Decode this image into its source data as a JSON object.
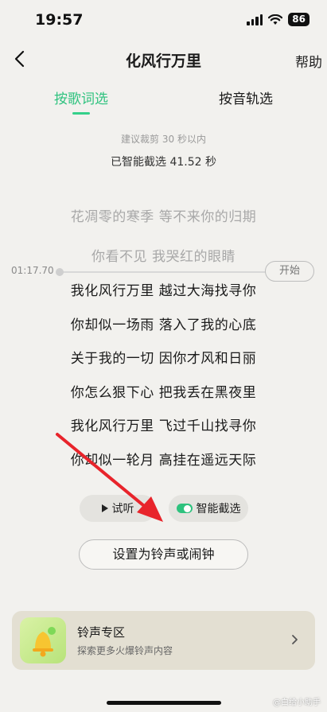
{
  "status_bar": {
    "time": "19:57",
    "battery": "86"
  },
  "nav": {
    "title": "化风行万里",
    "help_label": "帮助"
  },
  "tabs": [
    {
      "label": "按歌词选",
      "active": true
    },
    {
      "label": "按音轨选",
      "active": false
    }
  ],
  "clip": {
    "hint": "建议裁剪 30 秒以内",
    "selected": "已智能截选 41.52 秒"
  },
  "timeline": {
    "time": "01:17.70",
    "start_label": "开始"
  },
  "lyrics": [
    {
      "text": "花凋零的寒季 等不来你的归期",
      "state": "dim"
    },
    {
      "text": "你看不见 我哭红的眼睛",
      "state": "dim"
    },
    {
      "text": "我化风行万里 越过大海找寻你",
      "state": "active"
    },
    {
      "text": "你却似一场雨 落入了我的心底",
      "state": "active"
    },
    {
      "text": "关于我的一切 因你才风和日丽",
      "state": "active"
    },
    {
      "text": "你怎么狠下心 把我丢在黑夜里",
      "state": "active"
    },
    {
      "text": "我化风行万里 飞过千山找寻你",
      "state": "active"
    },
    {
      "text": "你却似一轮月 高挂在遥远天际",
      "state": "active"
    }
  ],
  "controls": {
    "preview_label": "试听",
    "smart_label": "智能截选",
    "smart_enabled": true,
    "set_ringtone_label": "设置为铃声或闹钟"
  },
  "banner": {
    "title": "铃声专区",
    "subtitle": "探索更多火爆铃声内容"
  },
  "watermark": "@白给小助手",
  "colors": {
    "accent": "#2ec27e",
    "arrow": "#e8242b",
    "background": "#f2f1ee"
  }
}
